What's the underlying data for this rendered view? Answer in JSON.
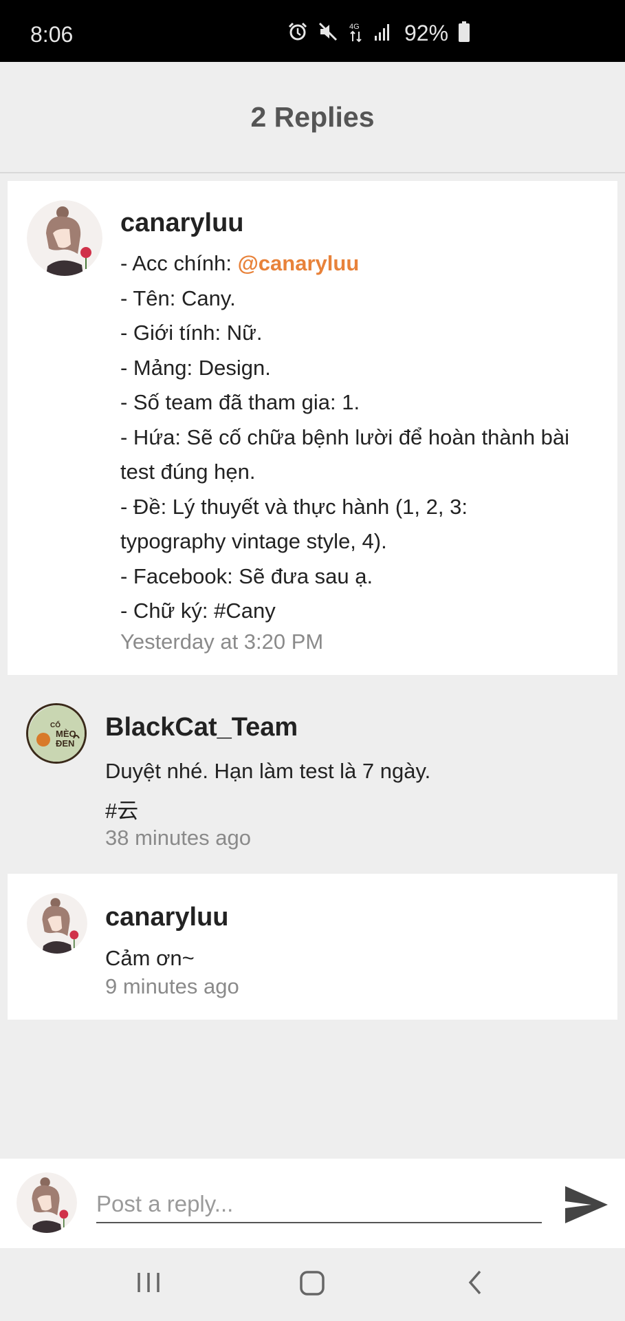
{
  "status_bar": {
    "time": "8:06",
    "battery": "92%",
    "icons": [
      "alarm-icon",
      "mute-icon",
      "4g-icon",
      "signal-icon",
      "battery-icon"
    ]
  },
  "header": {
    "title": "2 Replies"
  },
  "replies": [
    {
      "username": "canaryluu",
      "lines": [
        {
          "prefix": "- Acc chính: ",
          "mention": "@canaryluu"
        },
        {
          "text": "- Tên: Cany."
        },
        {
          "text": "- Giới tính: Nữ."
        },
        {
          "text": "- Mảng: Design."
        },
        {
          "text": "- Số team đã tham gia: 1."
        },
        {
          "text": "- Hứa: Sẽ cố chữa bệnh lười để hoàn thành bài"
        },
        {
          "text": "test đúng hẹn."
        },
        {
          "text": "- Đề: Lý thuyết và thực hành (1, 2, 3:"
        },
        {
          "text": "typography vintage style, 4)."
        },
        {
          "text": "- Facebook: Sẽ đưa sau ạ."
        },
        {
          "text": "- Chữ ký: #Cany"
        }
      ],
      "time": "Yesterday at 3:20 PM"
    },
    {
      "username": "BlackCat_Team",
      "lines": [
        {
          "text": "Duyệt nhé. Hạn làm test là 7 ngày."
        },
        {
          "text": "#云"
        }
      ],
      "time": "38 minutes ago",
      "avatar_text": [
        "CỔ",
        "MÈO",
        "ĐEN"
      ]
    },
    {
      "username": "canaryluu",
      "lines": [
        {
          "text": "Cảm ơn~"
        }
      ],
      "time": "9 minutes ago"
    }
  ],
  "reply_bar": {
    "placeholder": "Post a reply..."
  },
  "colors": {
    "accent": "#e8823a",
    "muted": "#8a8a8a",
    "background": "#eeeeee"
  }
}
